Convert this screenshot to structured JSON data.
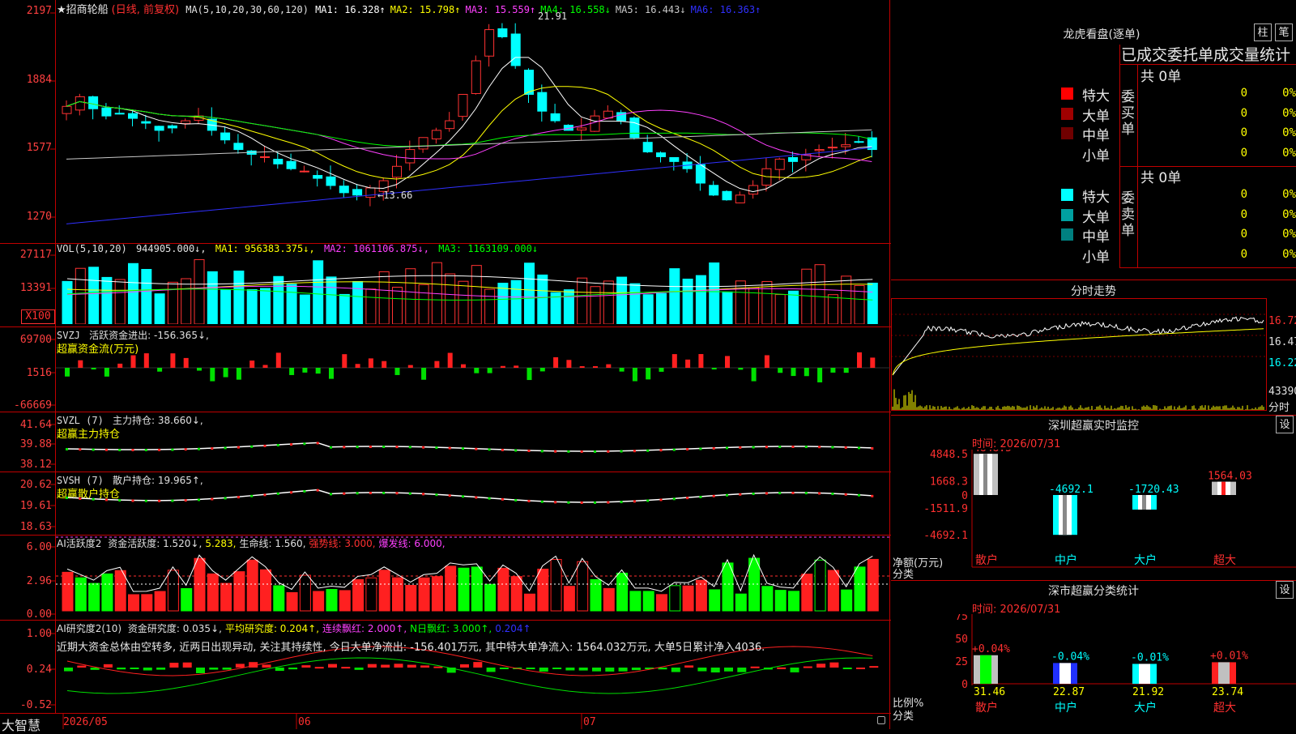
{
  "brand": "大智慧",
  "stock": {
    "title": "★招商轮船",
    "mode": "(日线, 前复权)"
  },
  "main_pane": {
    "ma_prefix": "MA(5,10,20,30,60,120)",
    "ma": [
      {
        "label": "MA1:",
        "value": "16.328↑",
        "color": "#ffffff"
      },
      {
        "label": "MA2:",
        "value": "15.798↑",
        "color": "#ffff00"
      },
      {
        "label": "MA3:",
        "value": "15.559↑",
        "color": "#ff40ff"
      },
      {
        "label": "MA4:",
        "value": "16.558↓",
        "color": "#00ff00"
      },
      {
        "label": "MA5:",
        "value": "16.443↓",
        "color": "#c8c8c8"
      },
      {
        "label": "MA6:",
        "value": "16.363↑",
        "color": "#3030ff"
      }
    ],
    "y_ticks": [
      "2197",
      "1884",
      "1577",
      "1270"
    ],
    "high_marker": "21.91",
    "low_marker": "←13.66"
  },
  "vol_pane": {
    "prefix": "VOL(5,10,20)",
    "value": "944905.000↓,",
    "ma1": "MA1: 956383.375↓,",
    "ma2": "MA2: 1061106.875↓,",
    "ma3": "MA3: 1163109.000↓",
    "y_ticks": [
      "27117",
      "13391"
    ],
    "unit": "X100"
  },
  "svzj_pane": {
    "prefix": "SVZJ",
    "label": "活跃资金进出: -156.365↓,",
    "sub": "超赢资金流(万元)",
    "y_ticks": [
      "69700",
      "1516",
      "-66669"
    ]
  },
  "svzl_pane": {
    "prefix": "SVZL (7)",
    "label": "主力持仓: 38.660↓,",
    "sub": "超赢主力持仓",
    "y_ticks": [
      "41.64",
      "39.88",
      "38.12"
    ]
  },
  "svsh_pane": {
    "prefix": "SVSH (7)",
    "label": "散户持仓: 19.965↑,",
    "sub": "超赢散户持仓",
    "y_ticks": [
      "20.62",
      "19.61",
      "18.63"
    ]
  },
  "ai_act_pane": {
    "prefix": "AI活跃度2",
    "items": [
      {
        "text": "资金活跃度: 1.520↓,",
        "color": "#e0e0e0"
      },
      {
        "text": "5.283,",
        "color": "#ffff00"
      },
      {
        "text": "生命线: 1.560,",
        "color": "#e0e0e0"
      },
      {
        "text": "强势线: 3.000,",
        "color": "#ff3030"
      },
      {
        "text": "爆发线: 6.000,",
        "color": "#ff40ff"
      }
    ],
    "y_ticks": [
      "6.00",
      "2.96",
      "0.00"
    ]
  },
  "ai_res_pane": {
    "prefix": "AI研究度2(10)",
    "items": [
      {
        "text": "资金研究度: 0.035↓,",
        "color": "#e0e0e0"
      },
      {
        "text": "平均研究度: 0.204↑,",
        "color": "#ffff00"
      },
      {
        "text": "连续飘红: 2.000↑,",
        "color": "#ff40ff"
      },
      {
        "text": "N日飘红: 3.000↑,",
        "color": "#00ff00"
      },
      {
        "text": "0.204↑",
        "color": "#3030ff"
      }
    ],
    "comment": "近期大资金总体由空转多, 近两日出现异动, 关注其持续性, 今日大单净流出: -156.401万元, 其中特大单净流入: 1564.032万元, 大单5日累计净入4036.",
    "y_ticks": [
      "1.00",
      "0.24",
      "-0.52"
    ]
  },
  "x_axis": [
    "2026/05",
    "06",
    "07"
  ],
  "right_panel": {
    "lhb_title": "龙虎看盘(逐单)",
    "btn_zhu": "柱",
    "btn_bi": "笔",
    "stats_title": "已成交委托单成交量统计",
    "buy": {
      "side": "委买单",
      "total": "共 0单",
      "rows": [
        {
          "label": "特大",
          "count": "0",
          "pct": "0%",
          "color": "#ff0000"
        },
        {
          "label": "大单",
          "count": "0",
          "pct": "0%",
          "color": "#a00000"
        },
        {
          "label": "中单",
          "count": "0",
          "pct": "0%",
          "color": "#700000"
        },
        {
          "label": "小单",
          "count": "0",
          "pct": "0%",
          "color": ""
        }
      ]
    },
    "sell": {
      "side": "委卖单",
      "total": "共 0单",
      "rows": [
        {
          "label": "特大",
          "count": "0",
          "pct": "0%",
          "color": "#00ffff"
        },
        {
          "label": "大单",
          "count": "0",
          "pct": "0%",
          "color": "#00a0a0"
        },
        {
          "label": "中单",
          "count": "0",
          "pct": "0%",
          "color": "#008080"
        },
        {
          "label": "小单",
          "count": "0",
          "pct": "0%",
          "color": ""
        }
      ]
    },
    "intraday": {
      "title": "分时走势",
      "y_ticks": [
        "16.72",
        "16.47",
        "16.22"
      ],
      "vol_tick": "43390",
      "unit": "分时"
    },
    "monitor": {
      "title": "深圳超赢实时监控",
      "btn": "设",
      "time": "时间: 2026/07/31",
      "y_ticks": [
        "4848.5",
        "1668.3",
        "0",
        "-1511.9",
        "-4692.1"
      ],
      "ylabel1": "净额(万元)",
      "ylabel2": "分类",
      "bars": [
        {
          "cat": "散户",
          "value": "4848.5"
        },
        {
          "cat": "中户",
          "value": "-4692.1"
        },
        {
          "cat": "大户",
          "value": "-1720.43"
        },
        {
          "cat": "超大",
          "value": "1564.03"
        }
      ]
    },
    "classify": {
      "title": "深市超赢分类统计",
      "btn": "设",
      "time": "时间: 2026/07/31",
      "y_ticks": [
        "75",
        "50",
        "25",
        "0"
      ],
      "ylabel1": "比例%",
      "ylabel2": "分类",
      "bars": [
        {
          "cat": "散户",
          "change": "+0.04%",
          "value": "31.46"
        },
        {
          "cat": "中户",
          "change": "-0.04%",
          "value": "22.87"
        },
        {
          "cat": "大户",
          "change": "-0.01%",
          "value": "21.92"
        },
        {
          "cat": "超大",
          "change": "+0.01%",
          "value": "23.74"
        }
      ]
    }
  }
}
